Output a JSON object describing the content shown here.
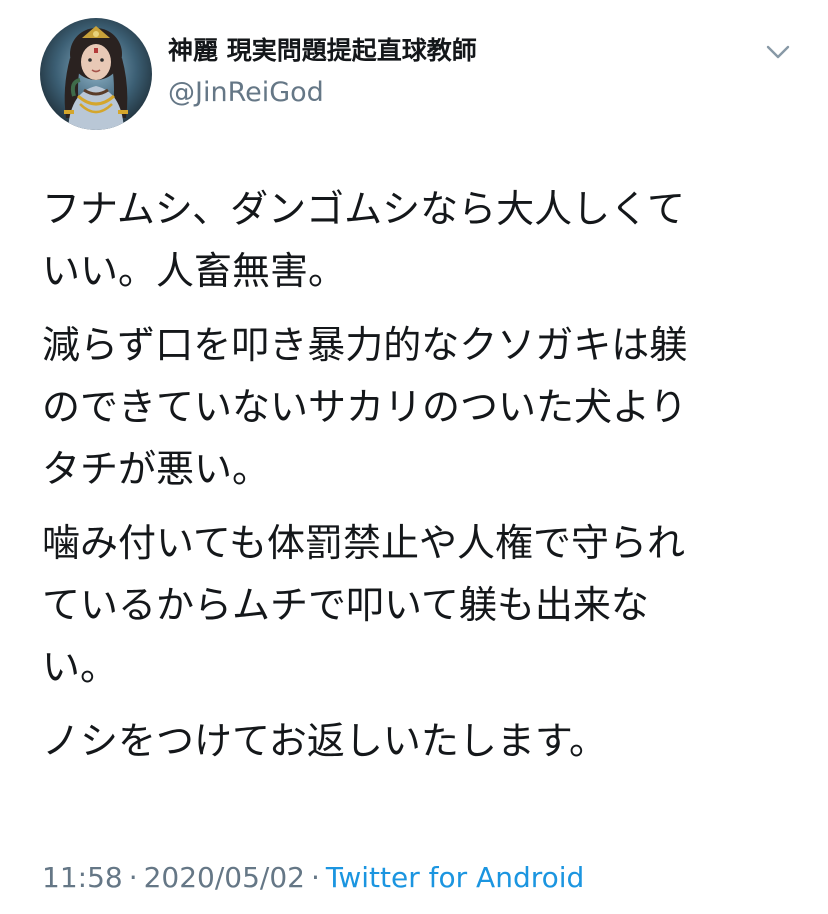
{
  "tweet": {
    "author": {
      "display_name": "神麗 現実問題提起直球教師",
      "handle": "@JinReiGod",
      "avatar_icon": "deity-portrait-avatar-icon"
    },
    "menu_icon": "chevron-down-icon",
    "paragraphs": [
      "フナムシ、ダンゴムシなら大人しくて\nいい。人畜無害。",
      "減らず口を叩き暴力的なクソガキは躾\nのできていないサカリのついた犬より\nタチが悪い。",
      "噛み付いても体罰禁止や人権で守られ\nているからムチで叩いて躾も出来な\nい。",
      "ノシをつけてお返しいたします。"
    ],
    "time": "11:58",
    "separator": "·",
    "date": "2020/05/02",
    "source": "Twitter for Android"
  },
  "colors": {
    "text": "#14171a",
    "secondary": "#657786",
    "link": "#1b95e0",
    "background": "#ffffff"
  }
}
